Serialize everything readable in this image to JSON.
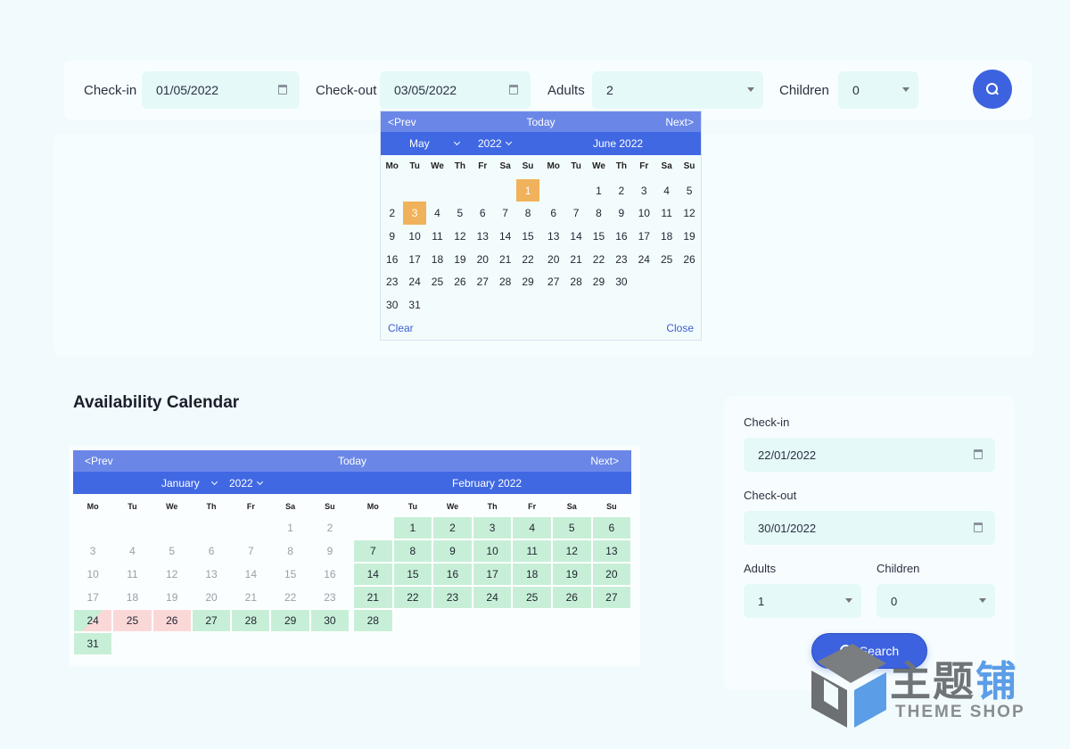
{
  "topbar": {
    "checkin_label": "Check-in",
    "checkin_value": "01/05/2022",
    "checkout_label": "Check-out",
    "checkout_value": "03/05/2022",
    "adults_label": "Adults",
    "adults_value": "2",
    "children_label": "Children",
    "children_value": "0"
  },
  "datepicker": {
    "prev": "<Prev",
    "today": "Today",
    "next": "Next>",
    "month_select": "May",
    "year_select": "2022",
    "second_month_title": "June 2022",
    "weekdays": [
      "Mo",
      "Tu",
      "We",
      "Th",
      "Fr",
      "Sa",
      "Su"
    ],
    "month1_days": [
      [
        "",
        "",
        "",
        "",
        "",
        "",
        "1"
      ],
      [
        "2",
        "3",
        "4",
        "5",
        "6",
        "7",
        "8"
      ],
      [
        "9",
        "10",
        "11",
        "12",
        "13",
        "14",
        "15"
      ],
      [
        "16",
        "17",
        "18",
        "19",
        "20",
        "21",
        "22"
      ],
      [
        "23",
        "24",
        "25",
        "26",
        "27",
        "28",
        "29"
      ],
      [
        "30",
        "31",
        "",
        "",
        "",
        "",
        ""
      ]
    ],
    "month2_days": [
      [
        "",
        "",
        "1",
        "2",
        "3",
        "4",
        "5"
      ],
      [
        "6",
        "7",
        "8",
        "9",
        "10",
        "11",
        "12"
      ],
      [
        "13",
        "14",
        "15",
        "16",
        "17",
        "18",
        "19"
      ],
      [
        "20",
        "21",
        "22",
        "23",
        "24",
        "25",
        "26"
      ],
      [
        "27",
        "28",
        "29",
        "30",
        "",
        "",
        ""
      ],
      [
        "",
        "",
        "",
        "",
        "",
        "",
        ""
      ]
    ],
    "selected_days": [
      "1",
      "3"
    ],
    "clear": "Clear",
    "close": "Close"
  },
  "availability": {
    "title": "Availability Calendar",
    "prev": "<Prev",
    "today": "Today",
    "next": "Next>",
    "month_select": "January",
    "year_select": "2022",
    "second_month_title": "February 2022",
    "weekdays": [
      "Mo",
      "Tu",
      "We",
      "Th",
      "Fr",
      "Sa",
      "Su"
    ],
    "month1_days": [
      [
        [
          "",
          ""
        ],
        [
          "",
          ""
        ],
        [
          "",
          ""
        ],
        [
          "",
          ""
        ],
        [
          "",
          ""
        ],
        [
          "1",
          "past"
        ],
        [
          "2",
          "past"
        ]
      ],
      [
        [
          "3",
          "past"
        ],
        [
          "4",
          "past"
        ],
        [
          "5",
          "past"
        ],
        [
          "6",
          "past"
        ],
        [
          "7",
          "past"
        ],
        [
          "8",
          "past"
        ],
        [
          "9",
          "past"
        ]
      ],
      [
        [
          "10",
          "past"
        ],
        [
          "11",
          "past"
        ],
        [
          "12",
          "past"
        ],
        [
          "13",
          "past"
        ],
        [
          "14",
          "past"
        ],
        [
          "15",
          "past"
        ],
        [
          "16",
          "past"
        ]
      ],
      [
        [
          "17",
          "past"
        ],
        [
          "18",
          "past"
        ],
        [
          "19",
          "past"
        ],
        [
          "20",
          "past"
        ],
        [
          "21",
          "past"
        ],
        [
          "22",
          "past"
        ],
        [
          "23",
          "past"
        ]
      ],
      [
        [
          "24",
          "half"
        ],
        [
          "25",
          "booked"
        ],
        [
          "26",
          "booked"
        ],
        [
          "27",
          "avail"
        ],
        [
          "28",
          "avail"
        ],
        [
          "29",
          "avail"
        ],
        [
          "30",
          "avail"
        ]
      ],
      [
        [
          "31",
          "avail"
        ],
        [
          "",
          ""
        ],
        [
          "",
          ""
        ],
        [
          "",
          ""
        ],
        [
          "",
          ""
        ],
        [
          "",
          ""
        ],
        [
          "",
          ""
        ]
      ]
    ],
    "month2_days": [
      [
        [
          "",
          ""
        ],
        [
          "1",
          "avail"
        ],
        [
          "2",
          "avail"
        ],
        [
          "3",
          "avail"
        ],
        [
          "4",
          "avail"
        ],
        [
          "5",
          "avail"
        ],
        [
          "6",
          "avail"
        ]
      ],
      [
        [
          "7",
          "avail"
        ],
        [
          "8",
          "avail"
        ],
        [
          "9",
          "avail"
        ],
        [
          "10",
          "avail"
        ],
        [
          "11",
          "avail"
        ],
        [
          "12",
          "avail"
        ],
        [
          "13",
          "avail"
        ]
      ],
      [
        [
          "14",
          "avail"
        ],
        [
          "15",
          "avail"
        ],
        [
          "16",
          "avail"
        ],
        [
          "17",
          "avail"
        ],
        [
          "18",
          "avail"
        ],
        [
          "19",
          "avail"
        ],
        [
          "20",
          "avail"
        ]
      ],
      [
        [
          "21",
          "avail"
        ],
        [
          "22",
          "avail"
        ],
        [
          "23",
          "avail"
        ],
        [
          "24",
          "avail"
        ],
        [
          "25",
          "avail"
        ],
        [
          "26",
          "avail"
        ],
        [
          "27",
          "avail"
        ]
      ],
      [
        [
          "28",
          "avail"
        ],
        [
          "",
          ""
        ],
        [
          "",
          ""
        ],
        [
          "",
          ""
        ],
        [
          "",
          ""
        ],
        [
          "",
          ""
        ],
        [
          "",
          ""
        ]
      ],
      [
        [
          "",
          ""
        ],
        [
          "",
          ""
        ],
        [
          "",
          ""
        ],
        [
          "",
          ""
        ],
        [
          "",
          ""
        ],
        [
          "",
          ""
        ],
        [
          "",
          ""
        ]
      ]
    ]
  },
  "sidebar_form": {
    "checkin_label": "Check-in",
    "checkin_value": "22/01/2022",
    "checkout_label": "Check-out",
    "checkout_value": "30/01/2022",
    "adults_label": "Adults",
    "adults_value": "1",
    "children_label": "Children",
    "children_value": "0",
    "search_label": "Search"
  },
  "watermark": {
    "zh_gray": "主题",
    "zh_blue": "铺",
    "en": "THEME SHOP"
  },
  "colors": {
    "accent": "#3d62e0",
    "header_light": "#6a87e8",
    "header_dark": "#4168e3",
    "available": "#c7efd7",
    "booked": "#fbd8d8",
    "selected": "#f0b25a",
    "field_bg": "#e4f9f8"
  }
}
